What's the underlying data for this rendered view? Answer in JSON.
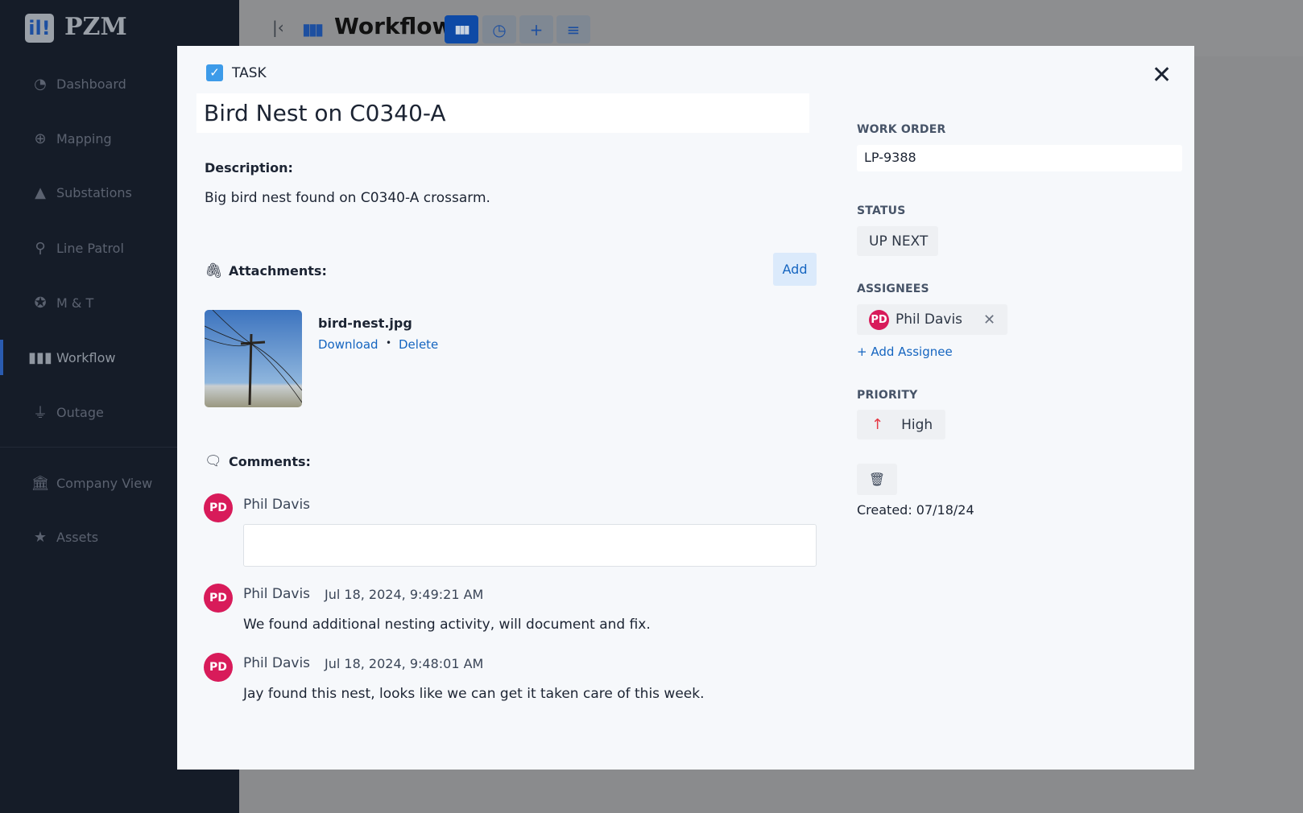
{
  "app": {
    "name": "PZM",
    "logo_glyph": "il!"
  },
  "sidebar": {
    "items": [
      {
        "label": "Dashboard",
        "icon": "gauge-icon"
      },
      {
        "label": "Mapping",
        "icon": "globe-icon"
      },
      {
        "label": "Substations",
        "icon": "warning-icon"
      },
      {
        "label": "Line Patrol",
        "icon": "route-icon"
      },
      {
        "label": "M & T",
        "icon": "badge-check-icon"
      },
      {
        "label": "Workflow",
        "icon": "columns-icon",
        "active": true
      },
      {
        "label": "Outage",
        "icon": "plug-icon"
      },
      {
        "label": "Company View",
        "icon": "bank-icon"
      },
      {
        "label": "Assets",
        "icon": "star-icon"
      }
    ]
  },
  "header": {
    "title": "Workflow",
    "buttons": [
      "board-view",
      "history",
      "add",
      "filter"
    ]
  },
  "task": {
    "type_label": "TASK",
    "title": "Bird Nest on C0340-A",
    "description_label": "Description:",
    "description": "Big bird nest found on C0340-A crossarm.",
    "attachments_label": "Attachments:",
    "add_label": "Add",
    "attachment": {
      "filename": "bird-nest.jpg",
      "download": "Download",
      "separator": "•",
      "delete": "Delete"
    },
    "comments_label": "Comments:",
    "current_user": {
      "initials": "PD",
      "name": "Phil Davis"
    },
    "comment_placeholder": "",
    "comments": [
      {
        "initials": "PD",
        "author": "Phil Davis",
        "date": "Jul 18, 2024, 9:49:21 AM",
        "text": "We found additional nesting activity, will document and fix."
      },
      {
        "initials": "PD",
        "author": "Phil Davis",
        "date": "Jul 18, 2024, 9:48:01 AM",
        "text": "Jay found this nest, looks like we can get it taken care of this week."
      }
    ]
  },
  "details": {
    "work_order_label": "WORK ORDER",
    "work_order": "LP-9388",
    "status_label": "STATUS",
    "status": "UP NEXT",
    "assignees_label": "ASSIGNEES",
    "assignees": [
      {
        "initials": "PD",
        "name": "Phil Davis"
      }
    ],
    "add_assignee": "Add Assignee",
    "priority_label": "PRIORITY",
    "priority": "High",
    "created": "Created: 07/18/24"
  },
  "colors": {
    "accent": "#1565c0",
    "avatar": "#d81b5a",
    "priority_high": "#e53945",
    "sidebar": "#151c28"
  }
}
